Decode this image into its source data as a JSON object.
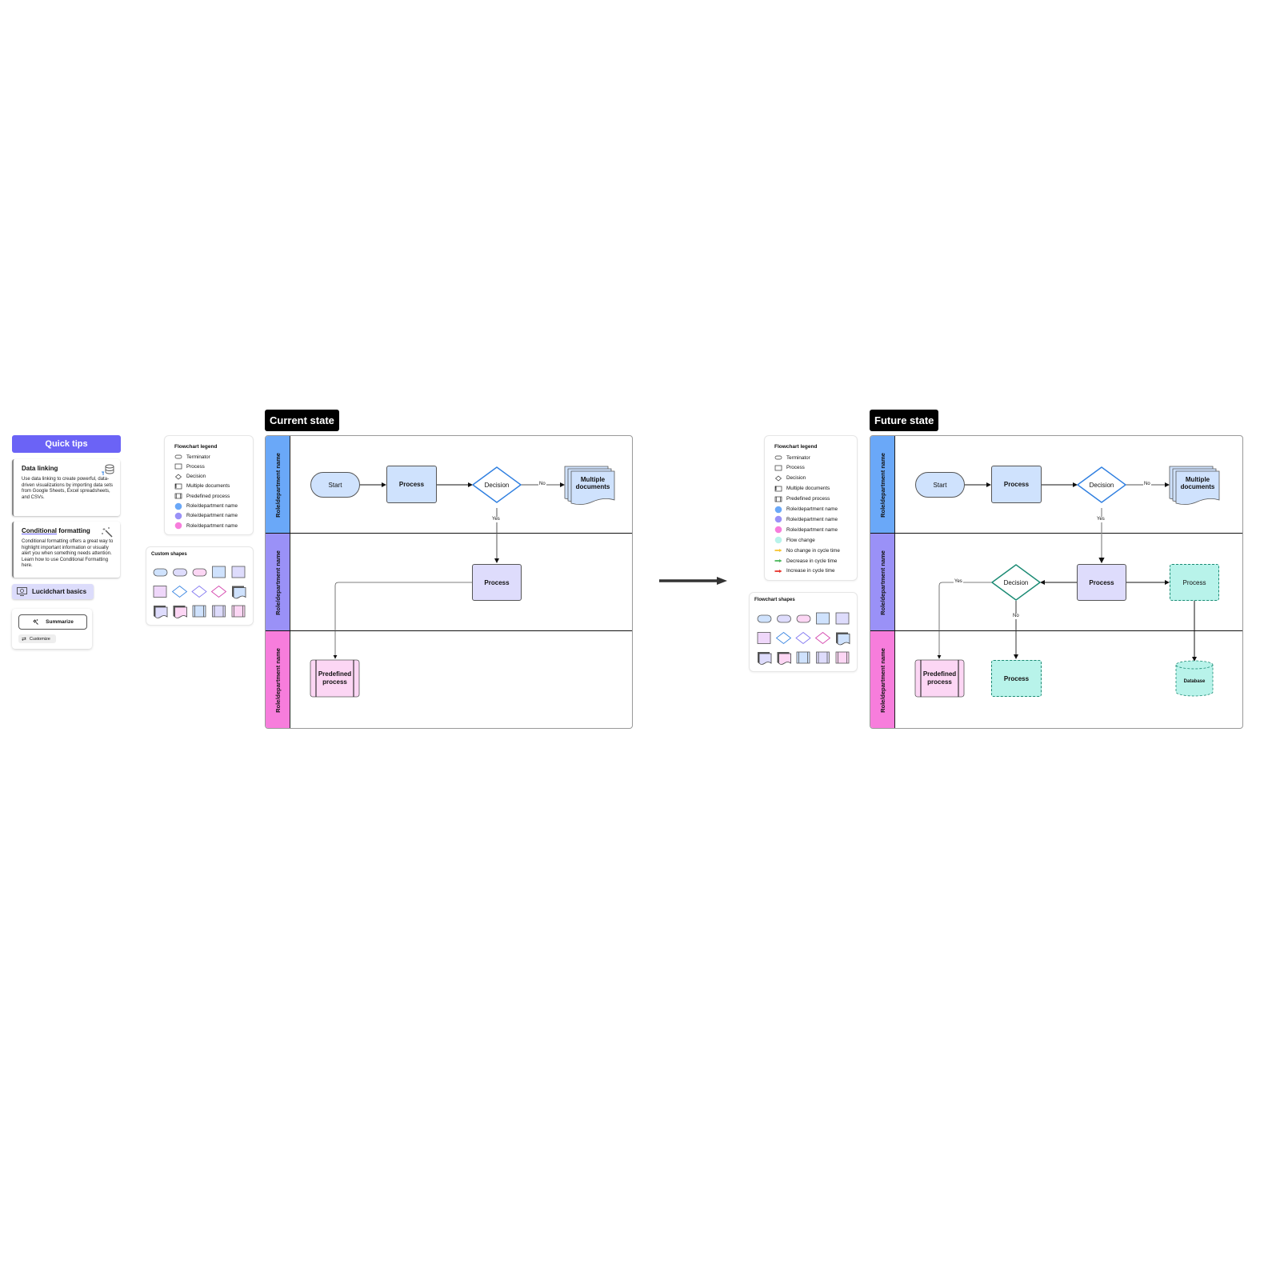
{
  "quick_tips": {
    "header": "Quick tips",
    "cards": [
      {
        "title": "Data linking",
        "icon": "database-link-icon",
        "body": "Use data linking to create powerful, data-driven visualizations by importing data sets from Google Sheets, Excel spreadsheets, and CSVs."
      },
      {
        "title_underlined": "Conditional",
        "title_rest": " formatting",
        "icon": "magic-wand-icon",
        "body": "Conditional formatting offers a great way to highlight important information or visually alert you when something needs attention. Learn how to use Conditional Formatting here."
      }
    ],
    "basics_label": "Lucidchart basics",
    "ai": {
      "summarize_label": "Summarize",
      "customize_label": "Customize"
    }
  },
  "current_legend": {
    "title": "Flowchart legend",
    "items": [
      {
        "icon": "terminator-icon",
        "label": "Terminator"
      },
      {
        "icon": "process-icon",
        "label": "Process"
      },
      {
        "icon": "decision-icon",
        "label": "Decision"
      },
      {
        "icon": "multiple-documents-icon",
        "label": "Multiple documents"
      },
      {
        "icon": "predefined-process-icon",
        "label": "Predefined process"
      },
      {
        "icon": "role-dot-icon",
        "color": "#6aa8f8",
        "label": "Role/department name"
      },
      {
        "icon": "role-dot-icon",
        "color": "#9a91f7",
        "label": "Role/department name"
      },
      {
        "icon": "role-dot-icon",
        "color": "#f77ddc",
        "label": "Role/department name"
      }
    ],
    "shapes_title": "Custom shapes"
  },
  "future_legend": {
    "title": "Flowchart legend",
    "items": [
      {
        "icon": "terminator-icon",
        "label": "Terminator"
      },
      {
        "icon": "process-icon",
        "label": "Process"
      },
      {
        "icon": "decision-icon",
        "label": "Decision"
      },
      {
        "icon": "multiple-documents-icon",
        "label": "Multiple documents"
      },
      {
        "icon": "predefined-process-icon",
        "label": "Predefined process"
      },
      {
        "icon": "role-dot-icon",
        "color": "#6aa8f8",
        "label": "Role/department name"
      },
      {
        "icon": "role-dot-icon",
        "color": "#9a91f7",
        "label": "Role/department name"
      },
      {
        "icon": "role-dot-icon",
        "color": "#f77ddc",
        "label": "Role/department name"
      },
      {
        "icon": "flow-change-dot-icon",
        "color": "#b8f3ea",
        "label": "Flow change"
      },
      {
        "icon": "arrow-icon",
        "color": "#f7c531",
        "label": "No change in cycle time"
      },
      {
        "icon": "arrow-icon",
        "color": "#4cb85c",
        "label": "Decrease in cycle time"
      },
      {
        "icon": "arrow-icon",
        "color": "#e8342c",
        "label": "Increase in cycle time"
      }
    ],
    "shapes_title": "Flowchart shapes"
  },
  "colors": {
    "lane1": "#6aa8f8",
    "lane2": "#9a91f7",
    "lane3": "#f77ddc",
    "blue_fill": "#cfe2fd",
    "purple_fill": "#dedcfc",
    "pink_fill": "#fcd6f4",
    "teal_fill": "#b8f3ea",
    "teal_stroke": "#1a8a73",
    "decision_blue": "#2f7fe0",
    "accent": "#6b63f6"
  },
  "current_state": {
    "label": "Current state",
    "lanes": [
      "Role/department name",
      "Role/department name",
      "Role/department name"
    ],
    "nodes": {
      "start": "Start",
      "process1": "Process",
      "decision": "Decision",
      "multidoc": "Multiple documents",
      "process2": "Process",
      "predefined": "Predefined process"
    },
    "edge_labels": {
      "no": "No",
      "yes": "Yes"
    }
  },
  "future_state": {
    "label": "Future state",
    "lanes": [
      "Role/department name",
      "Role/department name",
      "Role/department name"
    ],
    "nodes": {
      "start": "Start",
      "process1": "Process",
      "decision": "Decision",
      "multidoc": "Multiple documents",
      "process2": "Process",
      "decision2": "Decision",
      "process_new": "Process",
      "predefined": "Predefined process",
      "process_new2": "Process",
      "database": "Database"
    },
    "edge_labels": {
      "no": "No",
      "yes": "Yes",
      "yes2": "Yes",
      "no2": "No"
    }
  }
}
